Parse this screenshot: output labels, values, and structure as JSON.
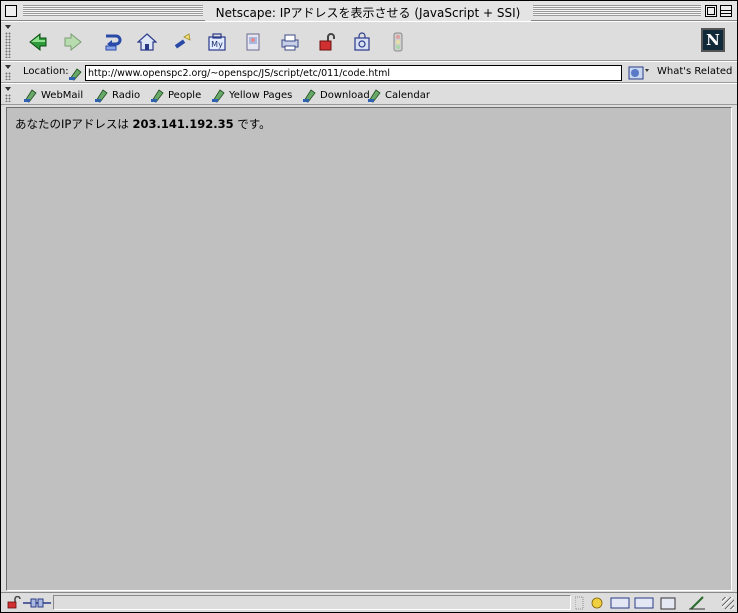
{
  "window": {
    "title": "Netscape: IPアドレスを表示させる (JavaScript + SSI)"
  },
  "navigation_toolbar": {
    "buttons": [
      {
        "name": "back",
        "icon": "back-arrow-icon"
      },
      {
        "name": "forward",
        "icon": "forward-arrow-icon"
      },
      {
        "name": "reload",
        "icon": "reload-icon"
      },
      {
        "name": "home",
        "icon": "home-icon"
      },
      {
        "name": "search",
        "icon": "search-flashlight-icon"
      },
      {
        "name": "my-netscape",
        "icon": "my-netscape-icon",
        "label": "My"
      },
      {
        "name": "images",
        "icon": "images-icon"
      },
      {
        "name": "print",
        "icon": "print-icon"
      },
      {
        "name": "security",
        "icon": "security-lock-icon"
      },
      {
        "name": "shop",
        "icon": "shop-bag-icon"
      },
      {
        "name": "stop",
        "icon": "stop-icon"
      }
    ],
    "logo": "N"
  },
  "location_bar": {
    "label": "Location:",
    "url": "http://www.openspc2.org/~openspc/JS/script/etc/011/code.html",
    "related_label": "What's Related"
  },
  "personal_toolbar": {
    "items": [
      "WebMail",
      "Radio",
      "People",
      "Yellow Pages",
      "Download",
      "Calendar"
    ]
  },
  "page": {
    "text_before": "あなたのIPアドレスは ",
    "ip_address": "203.141.192.35",
    "text_after": " です。"
  },
  "colors": {
    "content_background": "#c0c0c0",
    "chrome_background": "#dddddd"
  }
}
